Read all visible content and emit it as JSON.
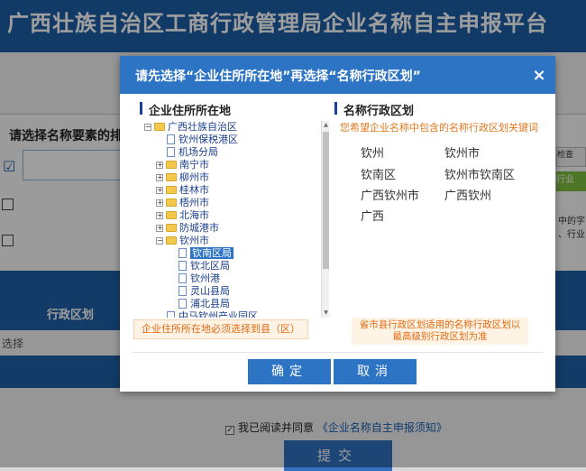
{
  "background": {
    "page_title": "广西壮族自治区工商行政管理局企业名称自主申报平台",
    "section_heading": "请选择名称要素的排",
    "band_label": "行政区划",
    "lower_text": "选择",
    "right_tab": "检查",
    "right_btn": "行业",
    "right_text_1": "中的字",
    "right_text_2": "、行业",
    "agree_prefix": "我已阅读并同意",
    "agree_link": "《企业名称自主申报须知》",
    "submit_label": "提交"
  },
  "modal": {
    "title": "请先选择“企业住所所在地”再选择“名称行政区划”",
    "close_icon": "×",
    "left_section_title": "企业住所所在地",
    "right_section_title": "名称行政区划",
    "right_subhint": "您希望企业名称中包含的名称行政区划关键词",
    "tree": [
      {
        "label": "广西壮族自治区",
        "kind": "folder",
        "toggle": "−"
      },
      {
        "label": "钦州保税港区",
        "kind": "doc"
      },
      {
        "label": "机场分局",
        "kind": "doc"
      },
      {
        "label": "南宁市",
        "kind": "folder",
        "toggle": "+"
      },
      {
        "label": "柳州市",
        "kind": "folder",
        "toggle": "+"
      },
      {
        "label": "桂林市",
        "kind": "folder",
        "toggle": "+"
      },
      {
        "label": "梧州市",
        "kind": "folder",
        "toggle": "+"
      },
      {
        "label": "北海市",
        "kind": "folder",
        "toggle": "+"
      },
      {
        "label": "防城港市",
        "kind": "folder",
        "toggle": "+"
      },
      {
        "label": "钦州市",
        "kind": "folder",
        "toggle": "−"
      },
      {
        "label": "钦南区局",
        "kind": "doc",
        "selected": true
      },
      {
        "label": "钦北区局",
        "kind": "doc"
      },
      {
        "label": "钦州港",
        "kind": "doc"
      },
      {
        "label": "灵山县局",
        "kind": "doc"
      },
      {
        "label": "浦北县局",
        "kind": "doc"
      },
      {
        "label": "中马钦州产业园区",
        "kind": "doc"
      }
    ],
    "left_hint": "企业住所所在地必须选择到县（区）",
    "keywords": [
      "钦州",
      "钦州市",
      "钦南区",
      "钦州市钦南区",
      "广西钦州市",
      "广西钦州",
      "广西"
    ],
    "right_hint_line1": "省市县行政区划适用的名称行政区划以",
    "right_hint_line2": "最高级别行政区划为准",
    "confirm_label": "确定",
    "cancel_label": "取消"
  }
}
